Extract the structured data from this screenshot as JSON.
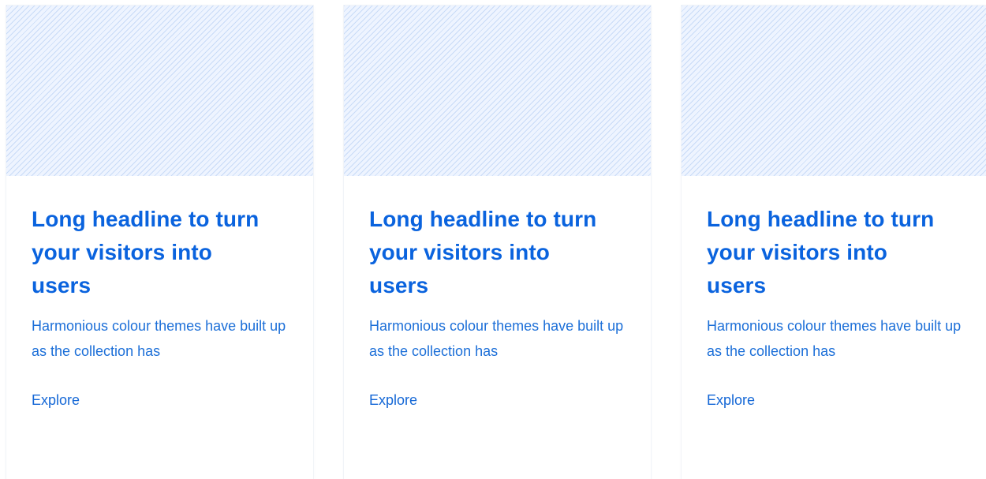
{
  "cards": [
    {
      "title": "Long headline to turn your visitors into users",
      "description": "Harmonious colour themes have built up as the collection has",
      "link_label": "Explore"
    },
    {
      "title": "Long headline to turn your visitors into users",
      "description": "Harmonious colour themes have built up as the collection has",
      "link_label": "Explore"
    },
    {
      "title": "Long headline to turn your visitors into users",
      "description": "Harmonious colour themes have built up as the collection has",
      "link_label": "Explore"
    }
  ],
  "colors": {
    "accent": "#0a63de",
    "text": "#1c6fd8",
    "image_placeholder": "#eef4ff"
  }
}
